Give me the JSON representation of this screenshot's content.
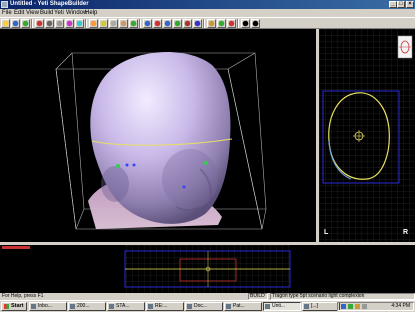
{
  "window": {
    "title": "Untitled - Yeti ShapeBuilder"
  },
  "menu": [
    "File",
    "Edit",
    "View",
    "Build",
    "Yeti",
    "Window",
    "Help"
  ],
  "toolbar": {
    "button_colors": [
      "#ffcc33",
      "#3366cc",
      "#33aa33",
      "#cc3333",
      "#666666",
      "#999999",
      "#cc33cc",
      "#33cccc",
      "#ff9933",
      "#cccc33",
      "#aaaaaa",
      "#cc9966",
      "#33aa33",
      "#3366cc",
      "#cc3333",
      "#3366cc",
      "#33aa33",
      "#aa3333",
      "#3333cc",
      "#cc9933",
      "#33aa33",
      "#cc3333",
      "#000000",
      "#000000"
    ]
  },
  "viewport_2d": {
    "left_label": "L",
    "right_label": "R"
  },
  "status": {
    "help": "For Help, press F1",
    "mode": "BUILD",
    "scenario": "Tragon type 5pt scenario light complexion"
  },
  "taskbar": {
    "start": "Start",
    "tasks": [
      "Inbo...",
      "200...",
      "STA...",
      "RE:...",
      "Doc...",
      "Pat...",
      "Unti...",
      "[...]"
    ],
    "active_task": "Unti...",
    "clock": "4:34 PM"
  },
  "colors": {
    "titlebar": "#0a246a",
    "viewport_bg": "#000000",
    "face_surface": "#c8b8e8",
    "contour": "#e8e060",
    "contour_cool": "#6aa0e0",
    "slice_plane": "#2a2ad8",
    "marker_green": "#33cc55",
    "marker_blue": "#3344ff"
  }
}
